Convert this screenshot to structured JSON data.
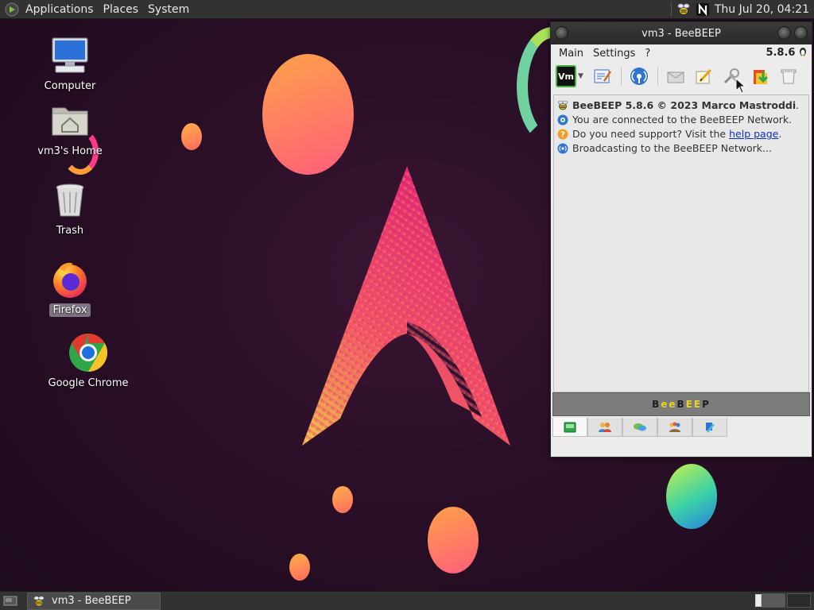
{
  "top_panel": {
    "menus": [
      "Applications",
      "Places",
      "System"
    ],
    "clock": "Thu Jul 20, 04:21",
    "tray_icons": [
      "beebeep-tray-icon",
      "network-n-icon"
    ]
  },
  "desktop": {
    "icons": [
      {
        "label": "Computer",
        "icon": "computer-icon"
      },
      {
        "label": "vm3's Home",
        "icon": "home-folder-icon"
      },
      {
        "label": "Trash",
        "icon": "trash-icon"
      },
      {
        "label": "Firefox",
        "icon": "firefox-icon"
      },
      {
        "label": "Google Chrome",
        "icon": "chrome-icon"
      }
    ]
  },
  "window": {
    "title": "vm3 - BeeBEEP",
    "menu": [
      "Main",
      "Settings",
      "?"
    ],
    "version": "5.8.6",
    "log": {
      "line1": "BeeBEEP 5.8.6 © 2023 Marco Mastroddi",
      "line1_end": ".",
      "line2": "You are connected to the BeeBEEP Network.",
      "line3_pre": "Do you need support? Visit the ",
      "line3_link": "help page",
      "line3_end": ".",
      "line4": "Broadcasting to the BeeBEEP Network..."
    },
    "banner": {
      "p1": "B",
      "p2": "ee",
      "p3": "B",
      "p4": "EE",
      "p5": "P"
    },
    "toolbar_vm_label": "Vm"
  },
  "taskbar": {
    "task_label": "vm3 - BeeBEEP"
  },
  "colors": {
    "panel": "#323232",
    "desktop_bg": "#2a0f27",
    "link": "#0b34c4",
    "banner": "#7c7c7c"
  }
}
